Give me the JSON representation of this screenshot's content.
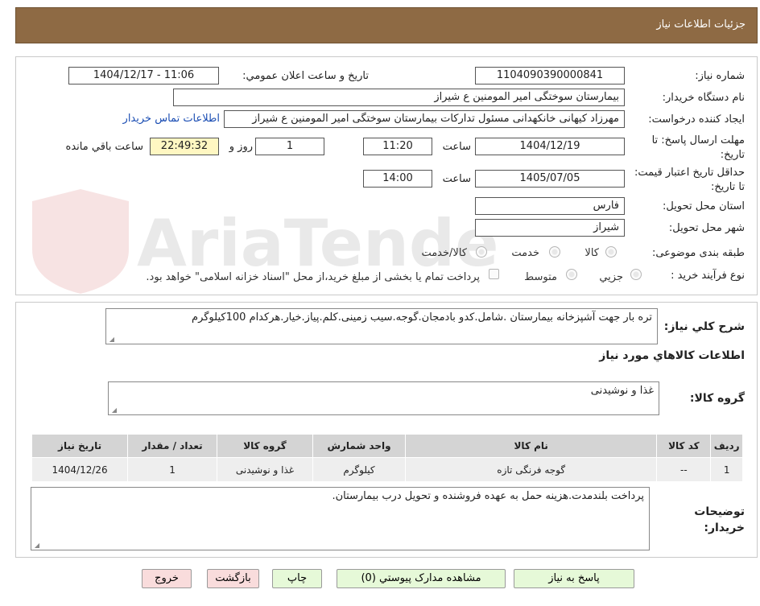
{
  "header": {
    "title": "جزئیات اطلاعات نیاز"
  },
  "fields": {
    "need_number": {
      "label": "شماره نیاز:",
      "value": "1104090390000841"
    },
    "announce_datetime": {
      "label": "تاریخ و ساعت اعلان عمومي:",
      "value": "1404/12/17 - 11:06"
    },
    "buyer_org": {
      "label": "نام دستگاه خریدار:",
      "value": "بیمارستان سوختگی امیر المومنین  ع  شیراز"
    },
    "requester": {
      "label": "ایجاد کننده درخواست:",
      "value": "مهرزاد کیهانی خانکهدانی مسئول تدارکات بیمارستان سوختگی امیر المومنین  ع  شیراز"
    },
    "contact_link": "اطلاعات تماس خریدار",
    "response_deadline": {
      "label": "مهلت ارسال پاسخ: تا تاریخ:",
      "date": "1404/12/19",
      "time_label": "ساعت",
      "time": "11:20",
      "days": "1",
      "days_label": "روز و",
      "remaining": "22:49:32",
      "remaining_label": "ساعت باقي مانده"
    },
    "price_validity": {
      "label": "حداقل تاریخ اعتبار قیمت: تا تاریخ:",
      "date": "1405/07/05",
      "time_label": "ساعت",
      "time": "14:00"
    },
    "province": {
      "label": "استان محل تحویل:",
      "value": "فارس"
    },
    "city": {
      "label": "شهر محل تحویل:",
      "value": "شیراز"
    },
    "category": {
      "label": "طبقه بندی موضوعی:",
      "options": [
        "کالا",
        "خدمت",
        "کالا/خدمت"
      ]
    },
    "process": {
      "label": "نوع فرآیند خرید :",
      "options": [
        "جزیي",
        "متوسط"
      ],
      "note": "پرداخت تمام یا بخشی از مبلغ خرید،از محل \"اسناد خزانه اسلامی\" خواهد بود."
    }
  },
  "description": {
    "label": "شرح کلي نیاز:",
    "value": "تره بار جهت آشپزخانه بیمارستان .شامل.کدو بادمجان.گوجه.سیب زمینی.کلم.پیاز.خیار.هرکدام 100کیلوگرم"
  },
  "goods_section_title": "اطلاعات کالاهاي مورد نیاز",
  "goods_group": {
    "label": "گروه کالا:",
    "value": "غذا و نوشیدنی"
  },
  "table": {
    "headers": [
      "ردیف",
      "کد کالا",
      "نام کالا",
      "واحد شمارش",
      "گروه کالا",
      "تعداد / مقدار",
      "تاریخ نیاز"
    ],
    "rows": [
      [
        "1",
        "--",
        "گوجه فرنگی تازه",
        "کیلوگرم",
        "غذا و نوشیدنی",
        "1",
        "1404/12/26"
      ]
    ]
  },
  "buyer_notes": {
    "label": "توضیحات خریدار:",
    "value": "پرداخت بلندمدت.هزینه حمل به عهده فروشنده و تحویل درب بیمارستان."
  },
  "buttons": {
    "reply": "پاسخ به نیاز",
    "attachments": "مشاهده مدارک پیوستي (0)",
    "print": "چاپ",
    "back": "بازگشت",
    "exit": "خروج"
  },
  "watermark_text": "AriaTender.neT",
  "colors": {
    "header": "#8e6a44",
    "link": "#1a4db3",
    "remaining_bg": "#fff7c2",
    "button_green": "#e6f9d8",
    "button_pink": "#f9dcdc"
  }
}
